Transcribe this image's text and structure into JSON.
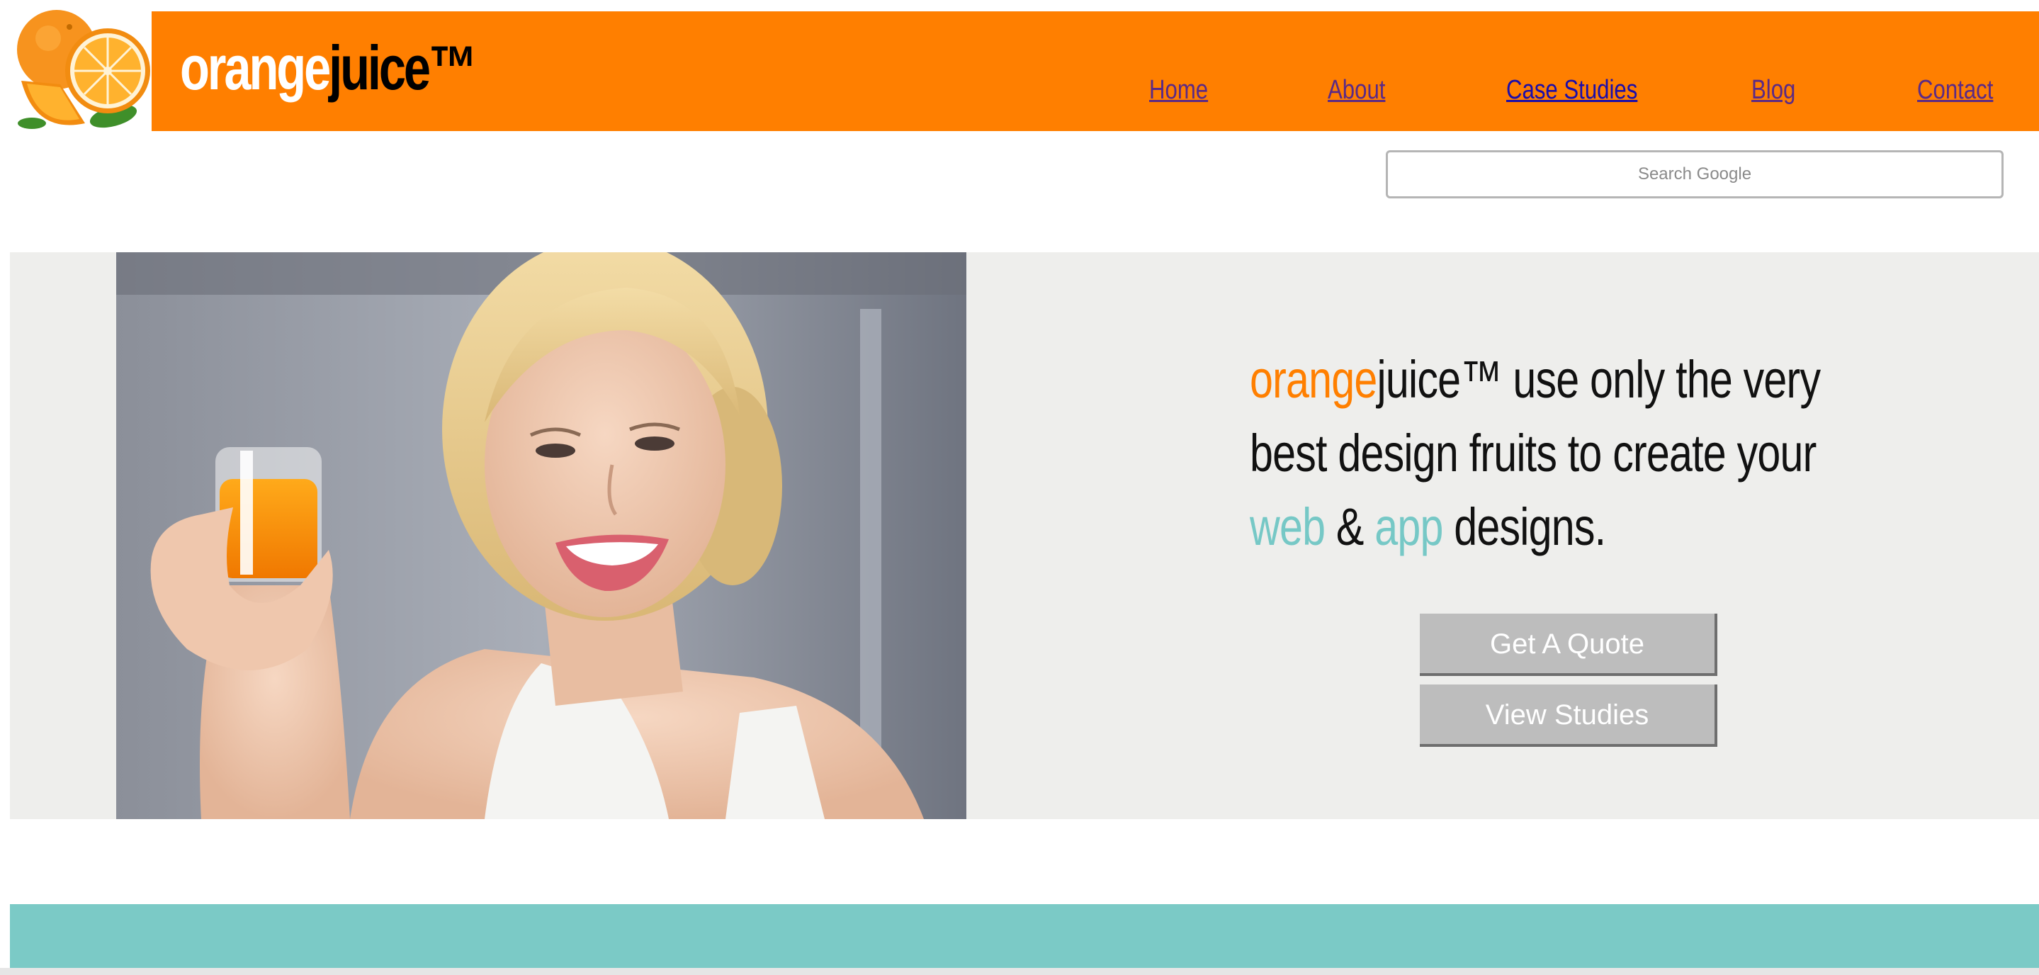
{
  "header": {
    "logo": "orange-fruit-logo",
    "brand_part1": "orange",
    "brand_part2": "juice™",
    "brand_color": "#ff7f00",
    "nav": [
      {
        "label": "Home"
      },
      {
        "label": "About"
      },
      {
        "label": "Case Studies"
      },
      {
        "label": "Blog"
      },
      {
        "label": "Contact"
      }
    ]
  },
  "search": {
    "placeholder": "Search Google"
  },
  "hero": {
    "photo": "woman-holding-orange-juice-photo",
    "headline": {
      "word_orange": "orange",
      "word_juice": "juice™ use only the very",
      "line2": "best design fruits to create your",
      "word_web": "web",
      "amp": " & ",
      "word_app": "app",
      "tail": " designs."
    },
    "accent_color": "#76c8c6",
    "buttons": {
      "quote": "Get A Quote",
      "studies": "View Studies"
    }
  },
  "colors": {
    "background": "#eeeeec",
    "teal_band": "#7bcac6"
  }
}
